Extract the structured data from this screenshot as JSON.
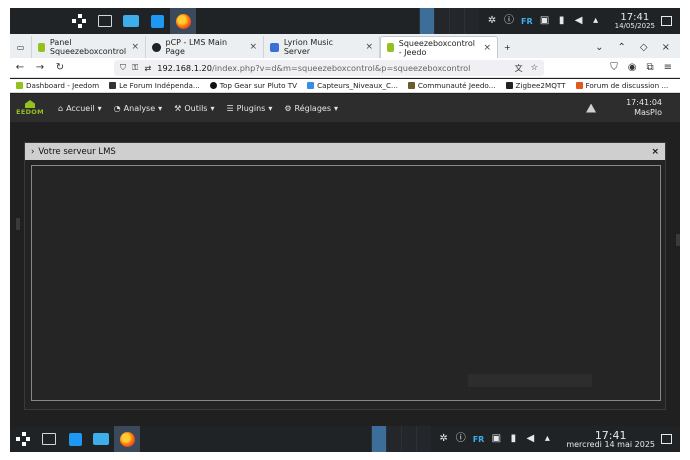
{
  "taskbar_top": {
    "pager_count": 4,
    "language": "FR",
    "clock_time": "17:41",
    "clock_date": "14/05/2025"
  },
  "browser": {
    "tabs": [
      {
        "label": "Panel Squeezeboxcontrol",
        "favicon_color": "#94c11f",
        "active": false
      },
      {
        "label": "pCP - LMS Main Page",
        "favicon_color": "#222222",
        "active": false
      },
      {
        "label": "Lyrion Music Server",
        "favicon_color": "#3b6fd8",
        "active": false
      },
      {
        "label": "Squeezeboxcontrol - Jeedo",
        "favicon_color": "#94c11f",
        "active": true
      }
    ],
    "url_host": "192.168.1.20",
    "url_path": "/index.php?v=d&m=squeezeboxcontrol&p=squeezeboxcontrol",
    "bookmarks": [
      {
        "label": "Dashboard - Jeedom",
        "color": "#94c11f"
      },
      {
        "label": "Le Forum Indépenda...",
        "color": "#333333"
      },
      {
        "label": "Top Gear sur Pluto TV",
        "color": "#111111"
      },
      {
        "label": "Capteurs_Niveaux_C...",
        "color": "#3a8ee6"
      },
      {
        "label": "Communauté Jeedo...",
        "color": "#6b5b2a"
      },
      {
        "label": "Zigbee2MQTT",
        "color": "#222222"
      },
      {
        "label": "Forum de discussion ...",
        "color": "#e05a1b"
      }
    ]
  },
  "jeedom": {
    "logo_text": "EEDOM",
    "menu": [
      {
        "label": "Accueil",
        "icon": "home-icon"
      },
      {
        "label": "Analyse",
        "icon": "chart-icon"
      },
      {
        "label": "Outils",
        "icon": "wrench-icon"
      },
      {
        "label": "Plugins",
        "icon": "list-icon"
      },
      {
        "label": "Réglages",
        "icon": "gear-icon"
      }
    ],
    "time": "17:41:04",
    "user": "MasPlo"
  },
  "modal": {
    "title": "Votre serveur LMS"
  },
  "taskbar_bottom": {
    "language": "FR",
    "clock_time": "17:41",
    "clock_date": "mercredi 14 mai 2025"
  }
}
